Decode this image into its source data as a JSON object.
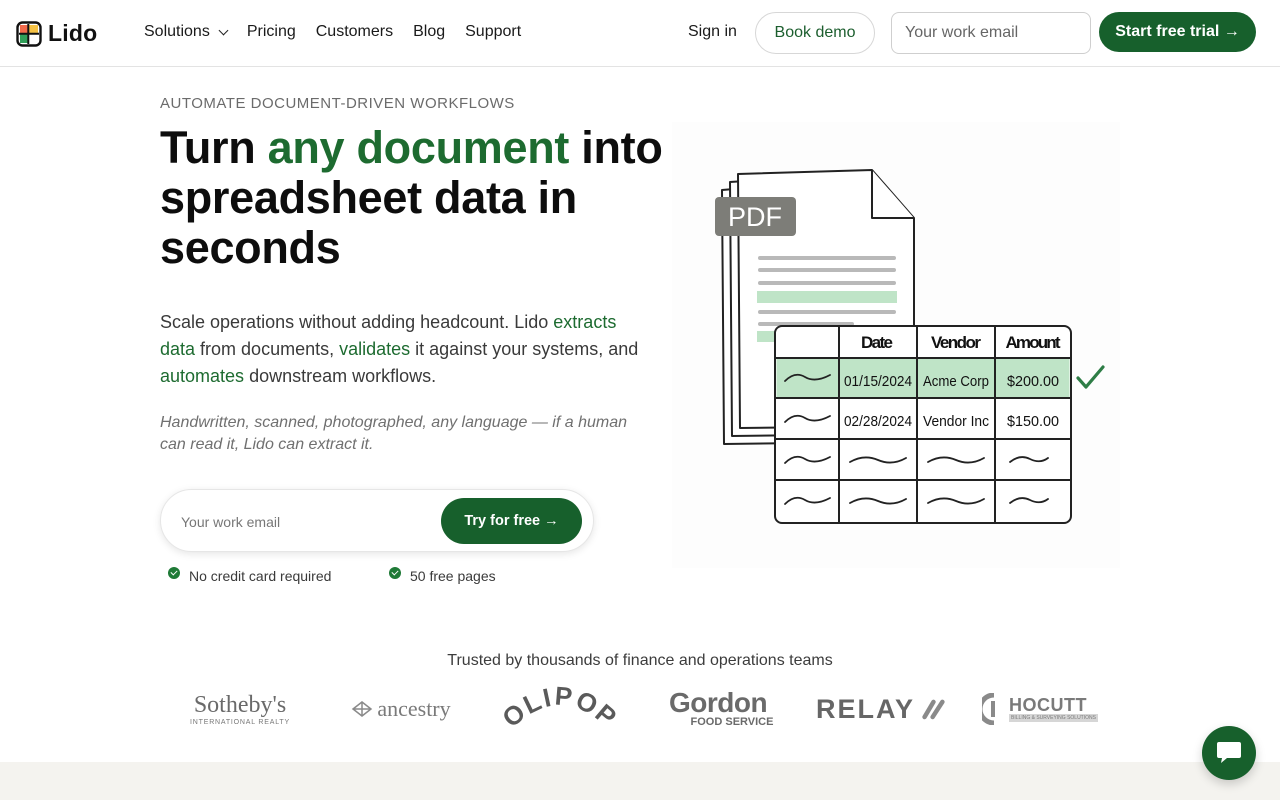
{
  "brand": {
    "name": "Lido",
    "accent": "#17602c",
    "accent_text": "#1d6b30"
  },
  "nav": {
    "links": [
      "Solutions",
      "Pricing",
      "Customers",
      "Blog",
      "Support"
    ],
    "sign_in": "Sign in",
    "book_demo": "Book demo",
    "email_placeholder": "Your work email",
    "start_trial": "Start free trial →"
  },
  "hero": {
    "eyebrow": "AUTOMATE DOCUMENT-DRIVEN WORKFLOWS",
    "headline_pre": "Turn ",
    "headline_highlight": "any document",
    "headline_post": " into spreadsheet data in seconds",
    "sub": {
      "p1": "Scale operations without adding headcount. Lido ",
      "link1": "extracts data",
      "p2": " from documents, ",
      "link2": "validates",
      "p3": " it against your systems, and ",
      "link3": "automates",
      "p4": " downstream workflows."
    },
    "tagline": "Handwritten, scanned, photographed, any language — if a human can read it, Lido can extract it.",
    "email_placeholder": "Your work email",
    "cta": "Try for free →",
    "perks": [
      "No credit card required",
      "50 free pages"
    ]
  },
  "illustration": {
    "doc_label": "PDF",
    "table": {
      "headers": [
        "",
        "Date",
        "Vendor",
        "Amount"
      ],
      "rows": [
        [
          "",
          "01/15/2024",
          "Acme Corp",
          "$200.00"
        ],
        [
          "",
          "02/28/2024",
          "Vendor Inc",
          "$150.00"
        ]
      ]
    }
  },
  "trusted": {
    "label": "Trusted by thousands of finance and operations teams",
    "logos": [
      {
        "name": "Sotheby's",
        "sub": "INTERNATIONAL REALTY"
      },
      {
        "name": "ancestry"
      },
      {
        "name": "OLIPOP"
      },
      {
        "name": "Gordon",
        "sub": "FOOD SERVICE"
      },
      {
        "name": "RELAY"
      },
      {
        "name": "HOCUTT",
        "sub": "BILLING & SURVEYING SOLUTIONS"
      }
    ]
  },
  "icons": [
    "chevron-down-icon",
    "arrow-right-icon",
    "check-icon",
    "chat-icon"
  ]
}
